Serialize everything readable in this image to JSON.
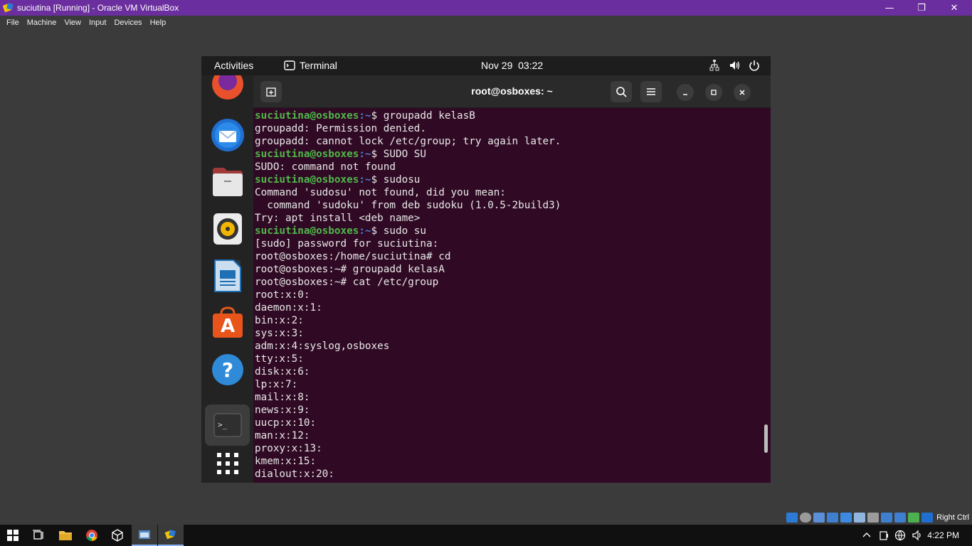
{
  "window": {
    "title": "suciutina [Running] - Oracle VM VirtualBox",
    "minimize_glyph": "—",
    "restore_glyph": "❐",
    "close_glyph": "✕"
  },
  "menu": [
    "File",
    "Machine",
    "View",
    "Input",
    "Devices",
    "Help"
  ],
  "gnome": {
    "activities": "Activities",
    "app_name": "Terminal",
    "date": "Nov 29",
    "time": "03:22",
    "tray_icons": [
      "network-icon",
      "volume-icon",
      "power-icon"
    ]
  },
  "dock": [
    "firefox-icon",
    "thunderbird-icon",
    "files-icon",
    "rhythmbox-icon",
    "libreoffice-writer-icon",
    "software-center-icon",
    "help-icon",
    "terminal-icon",
    "show-apps-icon"
  ],
  "terminal": {
    "title": "root@osboxes: ~",
    "lines": [
      {
        "user": "suciutina@osboxes",
        "path": ":~",
        "cmd": "$ groupadd kelasB"
      },
      {
        "text": "groupadd: Permission denied."
      },
      {
        "text": "groupadd: cannot lock /etc/group; try again later."
      },
      {
        "user": "suciutina@osboxes",
        "path": ":~",
        "cmd": "$ SUDO SU"
      },
      {
        "text": "SUDO: command not found"
      },
      {
        "user": "suciutina@osboxes",
        "path": ":~",
        "cmd": "$ sudosu"
      },
      {
        "text": "Command 'sudosu' not found, did you mean:"
      },
      {
        "text": "  command 'sudoku' from deb sudoku (1.0.5-2build3)"
      },
      {
        "text": "Try: apt install <deb name>"
      },
      {
        "user": "suciutina@osboxes",
        "path": ":~",
        "cmd": "$ sudo su"
      },
      {
        "text": "[sudo] password for suciutina:"
      },
      {
        "text": "root@osboxes:/home/suciutina# cd"
      },
      {
        "text": "root@osboxes:~# groupadd kelasA"
      },
      {
        "text": "root@osboxes:~# cat /etc/group"
      },
      {
        "text": "root:x:0:"
      },
      {
        "text": "daemon:x:1:"
      },
      {
        "text": "bin:x:2:"
      },
      {
        "text": "sys:x:3:"
      },
      {
        "text": "adm:x:4:syslog,osboxes"
      },
      {
        "text": "tty:x:5:"
      },
      {
        "text": "disk:x:6:"
      },
      {
        "text": "lp:x:7:"
      },
      {
        "text": "mail:x:8:"
      },
      {
        "text": "news:x:9:"
      },
      {
        "text": "uucp:x:10:"
      },
      {
        "text": "man:x:12:"
      },
      {
        "text": "proxy:x:13:"
      },
      {
        "text": "kmem:x:15:"
      },
      {
        "text": "dialout:x:20:"
      }
    ]
  },
  "vbox_status": {
    "host_key": "Right Ctrl"
  },
  "taskbar": {
    "time": "4:22 PM"
  },
  "colors": {
    "titlebar": "#6b2e9e",
    "terminal_bg": "#300a24",
    "prompt_user": "#4fb84a",
    "prompt_path": "#4e7fd0"
  }
}
